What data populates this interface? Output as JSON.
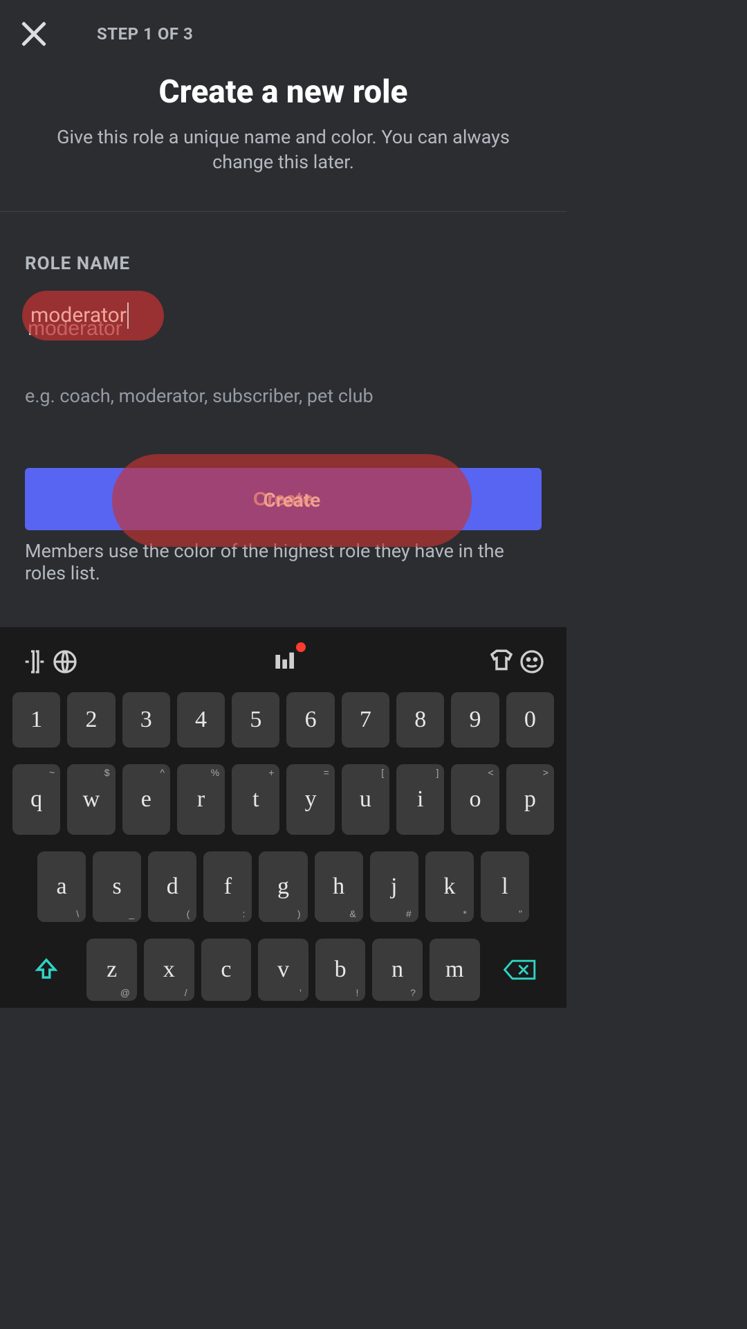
{
  "header": {
    "step_label": "STEP 1 OF 3"
  },
  "title": {
    "heading": "Create a new role",
    "subtitle": "Give this role a unique name and color. You can always change this later."
  },
  "form": {
    "field_label": "ROLE NAME",
    "input_value": "moderator",
    "hint": "e.g. coach, moderator, subscriber, pet club",
    "create_label": "Create",
    "footer_note": "Members use the color of the highest role they have in the roles list."
  },
  "keyboard": {
    "row_numbers": [
      "1",
      "2",
      "3",
      "4",
      "5",
      "6",
      "7",
      "8",
      "9",
      "0"
    ],
    "row_qwerty": [
      {
        "main": "q",
        "sup": "~"
      },
      {
        "main": "w",
        "sup": "$"
      },
      {
        "main": "e",
        "sup": "^"
      },
      {
        "main": "r",
        "sup": "%"
      },
      {
        "main": "t",
        "sup": "+"
      },
      {
        "main": "y",
        "sup": "="
      },
      {
        "main": "u",
        "sup": "["
      },
      {
        "main": "i",
        "sup": "]"
      },
      {
        "main": "o",
        "sup": "<"
      },
      {
        "main": "p",
        "sup": ">"
      }
    ],
    "row_asd": [
      {
        "main": "a",
        "sub": "\\"
      },
      {
        "main": "s",
        "sub": "_"
      },
      {
        "main": "d",
        "sub": "("
      },
      {
        "main": "f",
        "sub": ":"
      },
      {
        "main": "g",
        "sub": ")"
      },
      {
        "main": "h",
        "sub": "&"
      },
      {
        "main": "j",
        "sub": "#"
      },
      {
        "main": "k",
        "sub": "*"
      },
      {
        "main": "l",
        "sub": "\""
      }
    ],
    "row_zxc": [
      {
        "main": "z",
        "sub": "@"
      },
      {
        "main": "x",
        "sub": "/"
      },
      {
        "main": "c",
        "sub": ""
      },
      {
        "main": "v",
        "sub": "'"
      },
      {
        "main": "b",
        "sub": "!"
      },
      {
        "main": "n",
        "sub": "?"
      },
      {
        "main": "m",
        "sub": ""
      }
    ]
  }
}
